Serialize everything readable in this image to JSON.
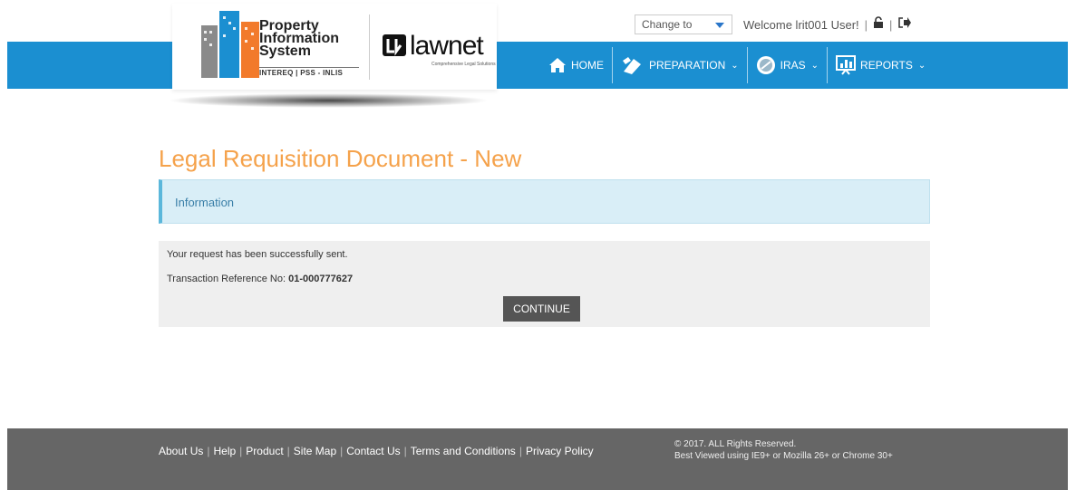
{
  "header": {
    "change_select": {
      "value": "Change to"
    },
    "welcome": "Welcome lrit001 User!",
    "separator": "|"
  },
  "logo": {
    "pis_line1": "Property",
    "pis_line2": "Information",
    "pis_line3": "System",
    "pis_sub": "INTEREQ | PSS - INLIS",
    "lawnet": "lawnet",
    "lawnet_tag": "Comprehensive Legal Solutions"
  },
  "nav": {
    "items": [
      {
        "label": "HOME",
        "icon": "home-icon"
      },
      {
        "label": "PREPARATION",
        "icon": "preparation-icon",
        "chevron": "⌄"
      },
      {
        "label": "IRAS",
        "icon": "iras-icon",
        "chevron": "⌄"
      },
      {
        "label": "REPORTS",
        "icon": "reports-icon",
        "chevron": "⌄"
      }
    ]
  },
  "main": {
    "title": "Legal Requisition Document - New",
    "info_heading": "Information",
    "success_message": "Your request has been successfully sent.",
    "ref_label": "Transaction Reference No: ",
    "ref_value": "01-000777627",
    "continue_label": "CONTINUE"
  },
  "footer": {
    "links": [
      "About Us",
      "Help",
      "Product",
      "Site Map",
      "Contact Us",
      "Terms and Conditions",
      "Privacy Policy"
    ],
    "pipe": "|",
    "copyright": "© 2017. ALL Rights Reserved.",
    "browser_note": "Best Viewed using IE9+ or Mozilla 26+ or Chrome 30+"
  },
  "colors": {
    "nav_blue": "#1b8fd1",
    "title_orange": "#f5a24b",
    "info_bg": "#d9eef7",
    "footer_gray": "#666666",
    "button_gray": "#555555"
  }
}
